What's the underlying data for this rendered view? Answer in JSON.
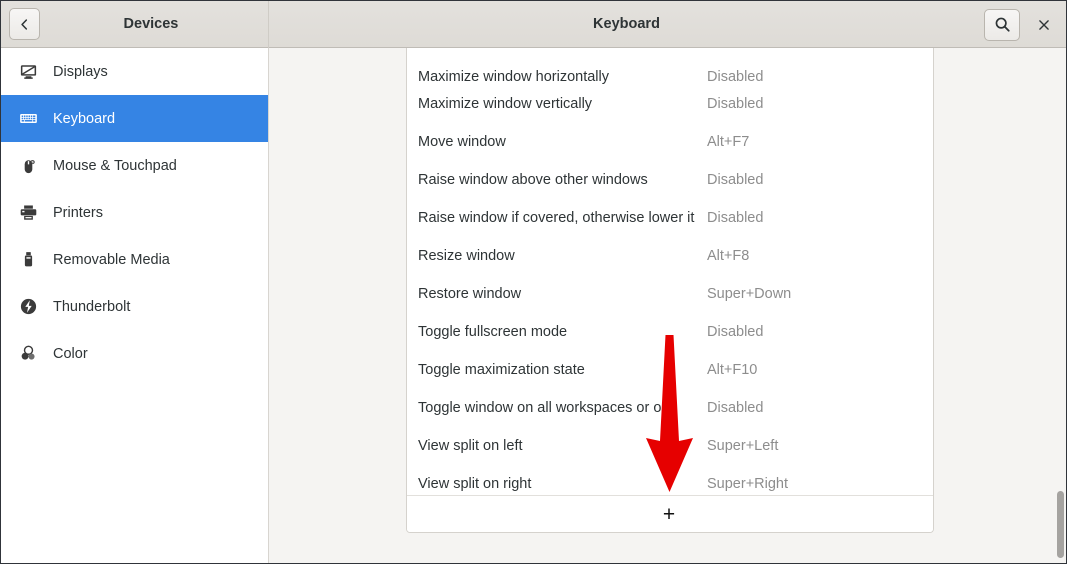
{
  "window": {
    "accent_color": "#3584e4",
    "annotation_color": "#e60000",
    "value_color": "#8d8d8d"
  },
  "header": {
    "sidebar_title": "Devices",
    "page_title": "Keyboard",
    "back_icon": "chevron-left-icon",
    "search_icon": "search-icon",
    "close_icon": "close-icon"
  },
  "sidebar": {
    "items": [
      {
        "label": "Displays",
        "icon": "display-icon",
        "selected": false
      },
      {
        "label": "Keyboard",
        "icon": "keyboard-icon",
        "selected": true
      },
      {
        "label": "Mouse & Touchpad",
        "icon": "mouse-icon",
        "selected": false
      },
      {
        "label": "Printers",
        "icon": "printer-icon",
        "selected": false
      },
      {
        "label": "Removable Media",
        "icon": "usb-drive-icon",
        "selected": false
      },
      {
        "label": "Thunderbolt",
        "icon": "thunderbolt-icon",
        "selected": false
      },
      {
        "label": "Color",
        "icon": "color-icon",
        "selected": false
      }
    ]
  },
  "shortcuts": {
    "rows": [
      {
        "name": "Maximize window horizontally",
        "value": "Disabled"
      },
      {
        "name": "Maximize window vertically",
        "value": "Disabled"
      },
      {
        "name": "Move window",
        "value": "Alt+F7"
      },
      {
        "name": "Raise window above other windows",
        "value": "Disabled"
      },
      {
        "name": "Raise window if covered, otherwise lower it",
        "value": "Disabled"
      },
      {
        "name": "Resize window",
        "value": "Alt+F8"
      },
      {
        "name": "Restore window",
        "value": "Super+Down"
      },
      {
        "name": "Toggle fullscreen mode",
        "value": "Disabled"
      },
      {
        "name": "Toggle maximization state",
        "value": "Alt+F10"
      },
      {
        "name": "Toggle window on all workspaces or one",
        "value": "Disabled"
      },
      {
        "name": "View split on left",
        "value": "Super+Left"
      },
      {
        "name": "View split on right",
        "value": "Super+Right"
      }
    ],
    "add_label": "+"
  },
  "annotation": {
    "kind": "red-down-arrow",
    "target": "add-shortcut-button"
  }
}
